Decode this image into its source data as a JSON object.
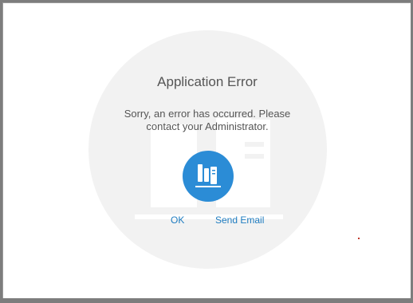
{
  "dialog": {
    "title": "Application Error",
    "message": "Sorry, an error has occurred. Please contact your Administrator.",
    "icon": "application-servers-icon",
    "buttons": {
      "ok_label": "OK",
      "send_email_label": "Send Email"
    }
  },
  "colors": {
    "accent": "#2b8cd6",
    "link": "#1e7cc0",
    "text": "#555555",
    "circle_bg": "#f2f2f2"
  }
}
